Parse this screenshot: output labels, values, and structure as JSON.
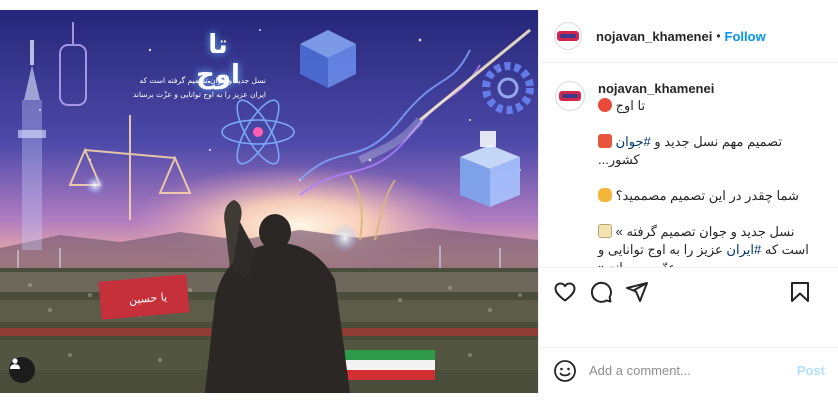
{
  "post": {
    "image": {
      "headline": "تا اوج",
      "subline_1": "نسل جدید و جوان تصمیم گرفته است که",
      "subline_2": "ایران عزیز را به اوج توانایی و عزّت برساند",
      "banner_text": "یا حسین"
    },
    "header": {
      "username": "nojavan_khamenei",
      "dot": "•",
      "follow_label": "Follow"
    },
    "caption": {
      "username": "nojavan_khamenei",
      "line_1": "تا اوج",
      "line_2_text": "تصمیم مهم نسل جدید و",
      "line_2_hash": "#جوان",
      "line_3": "کشور...",
      "line_4": "شما چقدر در این تصمیم مصممید؟",
      "line_5": "نسل جدید و جوان تصمیم گرفته »",
      "line_6_text": "است که",
      "line_6_hash": "#ایران",
      "line_6_rest": "عزیز را به اوج توانایی و",
      "line_7": "عزّت برساند.«"
    },
    "comment": {
      "placeholder": "Add a comment...",
      "post_label": "Post"
    },
    "colors": {
      "link": "#0095f6",
      "hashtag": "#00376b",
      "post_disabled": "#b2dffc",
      "border": "#efefef"
    },
    "icons": [
      "heart-icon",
      "comment-icon",
      "share-icon",
      "bookmark-icon",
      "emoji-icon",
      "user-tag-icon"
    ]
  }
}
